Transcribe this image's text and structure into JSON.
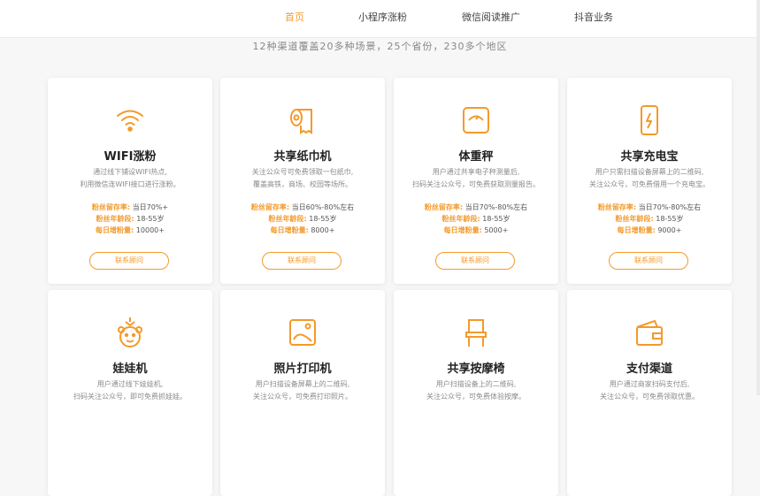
{
  "nav": {
    "items": [
      "首页",
      "小程序涨粉",
      "微信阅读推广",
      "抖音业务"
    ],
    "active_index": 0
  },
  "subtitle": "12种渠道覆盖20多种场景，25个省份，230多个地区",
  "accent_color": "#f39a2b",
  "cards": [
    {
      "icon": "wifi-icon",
      "title": "WIFI涨粉",
      "desc": [
        "通过线下铺设WIFI热点,",
        "利用微信连WIFI接口进行涨粉。"
      ],
      "stats": [
        {
          "k": "粉丝留存率:",
          "v": "当日70%+"
        },
        {
          "k": "粉丝年龄段:",
          "v": "18-55岁"
        },
        {
          "k": "每日增粉量:",
          "v": "10000+"
        }
      ],
      "button": "联系顾问"
    },
    {
      "icon": "tissue-roll-icon",
      "title": "共享纸巾机",
      "desc": [
        "关注公众号可免费领取一包纸巾,",
        "覆盖高铁，商场、校园等场所。"
      ],
      "stats": [
        {
          "k": "粉丝留存率:",
          "v": "当日60%-80%左右"
        },
        {
          "k": "粉丝年龄段:",
          "v": "18-55岁"
        },
        {
          "k": "每日增粉量:",
          "v": "8000+"
        }
      ],
      "button": "联系顾问"
    },
    {
      "icon": "scale-icon",
      "title": "体重秤",
      "desc": [
        "用户通过共享电子秤测量后,",
        "扫码关注公众号，可免费获取测量报告。"
      ],
      "stats": [
        {
          "k": "粉丝留存率:",
          "v": "当日70%-80%左右"
        },
        {
          "k": "粉丝年龄段:",
          "v": "18-55岁"
        },
        {
          "k": "每日增粉量:",
          "v": "5000+"
        }
      ],
      "button": "联系顾问"
    },
    {
      "icon": "power-bank-icon",
      "title": "共享充电宝",
      "desc": [
        "用户只需扫描设备屏幕上的二维码,",
        "关注公众号，可免费借用一个充电宝。"
      ],
      "stats": [
        {
          "k": "粉丝留存率:",
          "v": "当日70%-80%左右"
        },
        {
          "k": "粉丝年龄段:",
          "v": "18-55岁"
        },
        {
          "k": "每日增粉量:",
          "v": "9000+"
        }
      ],
      "button": "联系顾问"
    },
    {
      "icon": "claw-machine-icon",
      "title": "娃娃机",
      "desc": [
        "用户通过线下娃娃机,",
        "扫码关注公众号，即可免费抓娃娃。"
      ],
      "stats": [],
      "button": ""
    },
    {
      "icon": "photo-printer-icon",
      "title": "照片打印机",
      "desc": [
        "用户扫描设备屏幕上的二维码,",
        "关注公众号，可免费打印照片。"
      ],
      "stats": [],
      "button": ""
    },
    {
      "icon": "massage-chair-icon",
      "title": "共享按摩椅",
      "desc": [
        "用户扫描设备上的二维码,",
        "关注公众号，可免费体验按摩。"
      ],
      "stats": [],
      "button": ""
    },
    {
      "icon": "wallet-icon",
      "title": "支付渠道",
      "desc": [
        "用户通过商家扫码支付后,",
        "关注公众号，可免费领取优惠。"
      ],
      "stats": [],
      "button": ""
    }
  ]
}
